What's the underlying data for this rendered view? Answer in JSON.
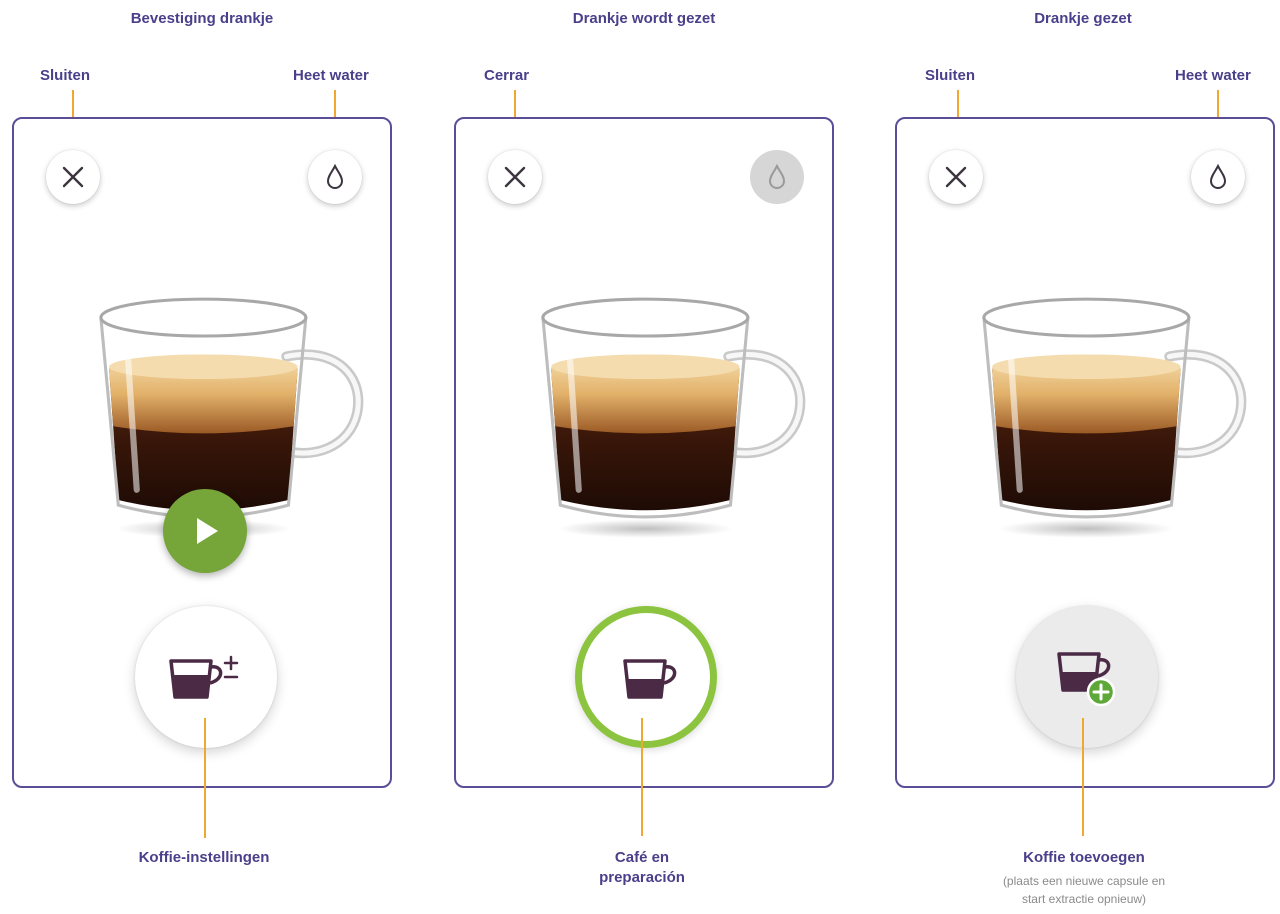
{
  "panels": [
    {
      "title": "Bevestiging drankje",
      "close_label": "Sluiten",
      "water_label": "Heet water",
      "bottom_label": "Koffie-instellingen",
      "close_icon": "close-icon",
      "water_icon": "water-drop-icon",
      "center_icon": "play-icon",
      "bottom_icon": "coffee-settings-icon"
    },
    {
      "title": "Drankje wordt gezet",
      "close_label": "Cerrar",
      "bottom_label_line1": "Café en",
      "bottom_label_line2": "preparación",
      "close_icon": "close-icon",
      "water_icon": "water-drop-icon",
      "water_state": "disabled",
      "bottom_icon": "coffee-cup-icon"
    },
    {
      "title": "Drankje gezet",
      "close_label": "Sluiten",
      "water_label": "Heet water",
      "bottom_label": "Koffie toevoegen",
      "bottom_sublabel_line1": "(plaats een nieuwe capsule en",
      "bottom_sublabel_line2": "start extractie opnieuw)",
      "close_icon": "close-icon",
      "water_icon": "water-drop-icon",
      "bottom_icon": "add-coffee-icon"
    }
  ],
  "colors": {
    "label": "#4a3f8a",
    "panel_border": "#5a4e98",
    "leader": "#f0a830",
    "accent_green": "#76a53a",
    "ring_green": "#8cc43f",
    "icon": "#4b2a45"
  }
}
